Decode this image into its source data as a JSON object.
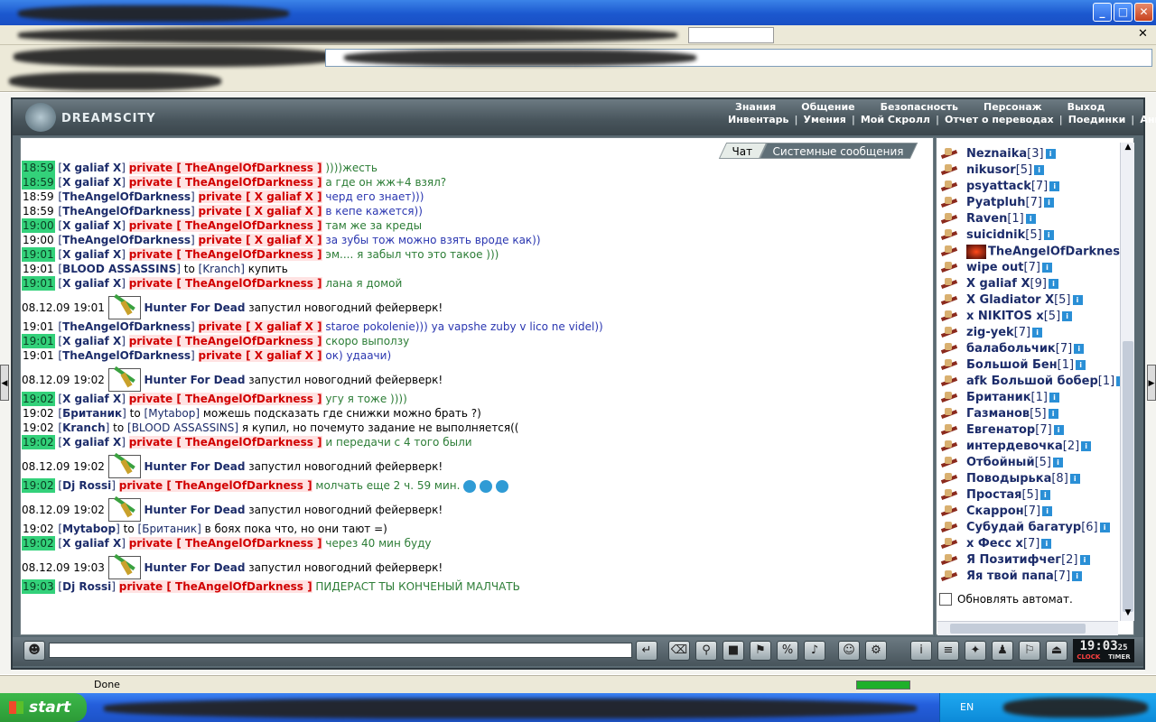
{
  "browser": {
    "status": "Done"
  },
  "game": {
    "logo": "DREAMSCITY",
    "menu_top": [
      "Знания",
      "Общение",
      "Безопасность",
      "Персонаж",
      "Выход"
    ],
    "menu_bottom": [
      "Инвентарь",
      "Умения",
      "Мой Скролл",
      "Отчет о переводах",
      "Поединки",
      "Анкета"
    ],
    "tabs": {
      "chat": "Чат",
      "system": "Системные сообщения"
    },
    "clock": {
      "time": "19:03",
      "seconds": "25",
      "label_clock": "CLOCK",
      "label_timer": "TIMER"
    },
    "auto_refresh": "Обновлять автомат."
  },
  "taskbar": {
    "start": "start",
    "lang": "EN"
  },
  "messages": [
    {
      "type": "chat",
      "time": "18:59",
      "hl": true,
      "from": "X galiaf X",
      "mode": "private",
      "to": "TheAngelOfDarkness",
      "text": "))))жесть",
      "color": "green"
    },
    {
      "type": "chat",
      "time": "18:59",
      "hl": true,
      "from": "X galiaf X",
      "mode": "private",
      "to": "TheAngelOfDarkness",
      "text": "а где он жж+4 взял?",
      "color": "green"
    },
    {
      "type": "chat",
      "time": "18:59",
      "hl": false,
      "from": "TheAngelOfDarkness",
      "mode": "private",
      "to": "X galiaf X",
      "text": "черд его знает)))",
      "color": "blue"
    },
    {
      "type": "chat",
      "time": "18:59",
      "hl": false,
      "from": "TheAngelOfDarkness",
      "mode": "private",
      "to": "X galiaf X",
      "text": "в кепе кажется))",
      "color": "blue"
    },
    {
      "type": "chat",
      "time": "19:00",
      "hl": true,
      "from": "X galiaf X",
      "mode": "private",
      "to": "TheAngelOfDarkness",
      "text": "там же за креды",
      "color": "green"
    },
    {
      "type": "chat",
      "time": "19:00",
      "hl": false,
      "from": "TheAngelOfDarkness",
      "mode": "private",
      "to": "X galiaf X",
      "text": "за зубы тож можно взять вроде как))",
      "color": "blue"
    },
    {
      "type": "chat",
      "time": "19:01",
      "hl": true,
      "from": "X galiaf X",
      "mode": "private",
      "to": "TheAngelOfDarkness",
      "text": "эм.... я забыл что это такое )))",
      "color": "green"
    },
    {
      "type": "chat",
      "time": "19:01",
      "hl": false,
      "from": "BLOOD ASSASSINS",
      "mode": "to",
      "to": "Kranch",
      "text": "купить",
      "color": "black"
    },
    {
      "type": "chat",
      "time": "19:01",
      "hl": true,
      "from": "X galiaf X",
      "mode": "private",
      "to": "TheAngelOfDarkness",
      "text": "лана я домой",
      "color": "green"
    },
    {
      "type": "system",
      "date": "08.12.09 19:01",
      "who": "Hunter For Dead",
      "text": "запустил новогодний фейерверк!"
    },
    {
      "type": "chat",
      "time": "19:01",
      "hl": false,
      "from": "TheAngelOfDarkness",
      "mode": "private",
      "to": "X galiaf X",
      "text": "staroe pokolenie))) ya vapshe zuby v lico ne videl))",
      "color": "blue"
    },
    {
      "type": "chat",
      "time": "19:01",
      "hl": true,
      "from": "X galiaf X",
      "mode": "private",
      "to": "TheAngelOfDarkness",
      "text": "скоро выползу",
      "color": "green"
    },
    {
      "type": "chat",
      "time": "19:01",
      "hl": false,
      "from": "TheAngelOfDarkness",
      "mode": "private",
      "to": "X galiaf X",
      "text": "ок) удаачи)",
      "color": "blue"
    },
    {
      "type": "system",
      "date": "08.12.09 19:02",
      "who": "Hunter For Dead",
      "text": "запустил новогодний фейерверк!"
    },
    {
      "type": "chat",
      "time": "19:02",
      "hl": true,
      "from": "X galiaf X",
      "mode": "private",
      "to": "TheAngelOfDarkness",
      "text": "угу я тоже ))))",
      "color": "green"
    },
    {
      "type": "chat",
      "time": "19:02",
      "hl": false,
      "from": "Британик",
      "mode": "to",
      "to": "Mytabop",
      "text": "можешь подсказать где снижки можно брать ?)",
      "color": "black"
    },
    {
      "type": "chat",
      "time": "19:02",
      "hl": false,
      "from": "Kranch",
      "mode": "to",
      "to": "BLOOD ASSASSINS",
      "text": "я купил, но почемуто задание не выполняется((",
      "color": "black"
    },
    {
      "type": "chat",
      "time": "19:02",
      "hl": true,
      "from": "X galiaf X",
      "mode": "private",
      "to": "TheAngelOfDarkness",
      "text": "и передачи с 4 того были",
      "color": "green"
    },
    {
      "type": "system",
      "date": "08.12.09 19:02",
      "who": "Hunter For Dead",
      "text": "запустил новогодний фейерверк!"
    },
    {
      "type": "chat",
      "time": "19:02",
      "hl": true,
      "from": "Dj Rossi",
      "mode": "private",
      "to": "TheAngelOfDarkness",
      "text": "молчать еще 2 ч. 59 мин.",
      "color": "green",
      "smiles": 3
    },
    {
      "type": "system",
      "date": "08.12.09 19:02",
      "who": "Hunter For Dead",
      "text": "запустил новогодний фейерверк!"
    },
    {
      "type": "chat",
      "time": "19:02",
      "hl": false,
      "from": "Mytabop",
      "mode": "to",
      "to": "Британик",
      "text": "в боях пока что, но они тают =)",
      "color": "black"
    },
    {
      "type": "chat",
      "time": "19:02",
      "hl": true,
      "from": "X galiaf X",
      "mode": "private",
      "to": "TheAngelOfDarkness",
      "text": "через 40 мин буду",
      "color": "green"
    },
    {
      "type": "system",
      "date": "08.12.09 19:03",
      "who": "Hunter For Dead",
      "text": "запустил новогодний фейерверк!"
    },
    {
      "type": "chat",
      "time": "19:03",
      "hl": true,
      "from": "Dj Rossi",
      "mode": "private",
      "to": "TheAngelOfDarkness",
      "text": "ПИДЕРАСТ ТЫ КОНЧЕНЫЙ МАЛЧАТЬ",
      "color": "green"
    }
  ],
  "users": [
    {
      "name": "Neznaika",
      "lvl": "3"
    },
    {
      "name": "nikusor",
      "lvl": "5"
    },
    {
      "name": "psyattack",
      "lvl": "7"
    },
    {
      "name": "Pyatpluh",
      "lvl": "7"
    },
    {
      "name": "Raven",
      "lvl": "1"
    },
    {
      "name": "suicidnik",
      "lvl": "5"
    },
    {
      "name": "TheAngelOfDarkness",
      "lvl": "",
      "clipped": "TheAngelOfDarknes"
    },
    {
      "name": "wipe out",
      "lvl": "7"
    },
    {
      "name": "X galiaf X",
      "lvl": "9"
    },
    {
      "name": "X Gladiator X",
      "lvl": "5"
    },
    {
      "name": "x NIKITOS x",
      "lvl": "5"
    },
    {
      "name": "zig-yek",
      "lvl": "7"
    },
    {
      "name": "балабольчик",
      "lvl": "7"
    },
    {
      "name": "Большой Бен",
      "lvl": "1"
    },
    {
      "name": "afk Большой бобер",
      "lvl": "1"
    },
    {
      "name": "Британик",
      "lvl": "1"
    },
    {
      "name": "Газманов",
      "lvl": "5"
    },
    {
      "name": "Евгенатор",
      "lvl": "7"
    },
    {
      "name": "интердевочка",
      "lvl": "2"
    },
    {
      "name": "Отбойный",
      "lvl": "5"
    },
    {
      "name": "Поводырька",
      "lvl": "8"
    },
    {
      "name": "Простая",
      "lvl": "5"
    },
    {
      "name": "Скаррон",
      "lvl": "7"
    },
    {
      "name": "Субудай багатур",
      "lvl": "6"
    },
    {
      "name": "x Фесс x",
      "lvl": "7"
    },
    {
      "name": "Я Позитифчег",
      "lvl": "2"
    },
    {
      "name": "Яя твой папа",
      "lvl": "7"
    }
  ]
}
